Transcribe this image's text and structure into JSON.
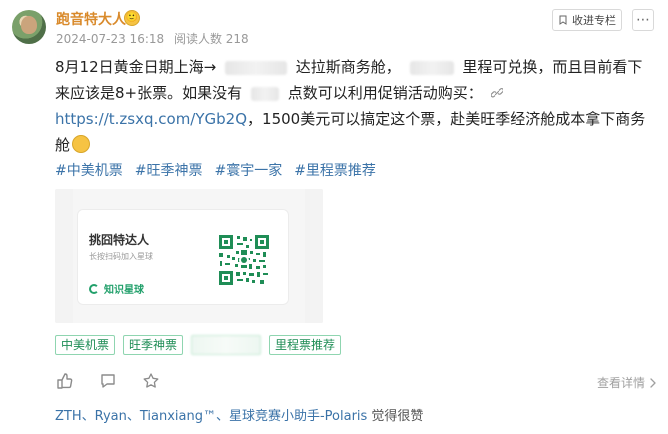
{
  "header": {
    "username": "跑音特大人",
    "badge_emoji": "🙂",
    "date": "2024-07-23 16:18",
    "views": "阅读人数 218",
    "collect_label": "收进专栏",
    "more_label": "⋯"
  },
  "post": {
    "part1": "8月12日黄金日期上海→",
    "part2": "达拉斯商务舱，",
    "part3": "里程可兑换，而且目前看下来应该是8+张票。如果没有",
    "part4": "点数可以利用促销活动购买：",
    "link_text": "https://t.zsxq.com/YGb2Q",
    "part5": "，1500美元可以搞定这个票，赴美旺季经济舱成本拿下商务舱"
  },
  "hashtags": [
    "#中美机票",
    "#旺季神票",
    "#寰宇一家",
    "#里程票推荐"
  ],
  "image_card": {
    "title": "挑囧特达人",
    "subtitle": "长按扫码加入星球",
    "brand": "知识星球"
  },
  "pills": [
    "中美机票",
    "旺季神票",
    "",
    "里程票推荐"
  ],
  "actions": {
    "details": "查看详情"
  },
  "likes": {
    "names": "ZTH、Ryan、Tianxiang™、星球竞赛小助手-Polaris",
    "suffix": " 觉得很赞"
  },
  "icons": {
    "collect": "bookmark-icon",
    "more": "more-icon",
    "like": "thumb-up-icon",
    "comment": "comment-icon",
    "star": "star-icon",
    "link": "link-icon",
    "chevron": "chevron-right-icon"
  },
  "colors": {
    "username": "#d98a2b",
    "link": "#3b73a8",
    "tag": "#3b73a8",
    "pill_border": "#8fd5b0",
    "pill_text": "#1f8d56"
  }
}
